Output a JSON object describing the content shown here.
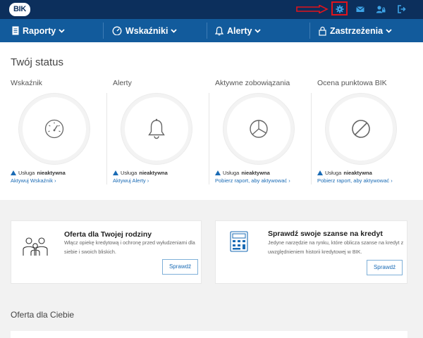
{
  "header": {
    "logo_text": "BIK",
    "icons": [
      "settings-icon",
      "mail-icon",
      "user-lock-icon",
      "logout-icon"
    ],
    "highlight_color": "#e0141c"
  },
  "nav": {
    "items": [
      {
        "label": "Raporty",
        "icon": "document-icon"
      },
      {
        "label": "Wskaźniki",
        "icon": "gauge-icon"
      },
      {
        "label": "Alerty",
        "icon": "bell-icon"
      },
      {
        "label": "Zastrzeżenia",
        "icon": "lock-icon"
      }
    ]
  },
  "status": {
    "title": "Twój status",
    "columns": [
      {
        "label": "Wskaźnik",
        "icon": "gauge-icon",
        "warn_prefix": "Usługa",
        "warn_state": "nieaktywna",
        "link": "Aktywuj Wskaźnik ›"
      },
      {
        "label": "Alerty",
        "icon": "bell-icon",
        "warn_prefix": "Usługa",
        "warn_state": "nieaktywna",
        "link": "Aktywuj Alerty ›"
      },
      {
        "label": "Aktywne zobowiązania",
        "icon": "pie-chart-icon",
        "warn_prefix": "Usługa",
        "warn_state": "nieaktywna",
        "link": "Pobierz raport, aby aktywować ›"
      },
      {
        "label": "Ocena punktowa BIK",
        "icon": "prohibited-icon",
        "warn_prefix": "Usługa",
        "warn_state": "nieaktywna",
        "link": "Pobierz raport, aby aktywować ›"
      }
    ]
  },
  "cards": [
    {
      "title": "Oferta dla Twojej rodziny",
      "description": "Włącz opiekę kredytową i ochronę przed wyłudzeniami dla siebie i swoich bliskich.",
      "button": "Sprawdź",
      "icon": "family-icon"
    },
    {
      "title": "Sprawdź swoje szanse na kredyt",
      "description": "Jedyne narzędzie na rynku, które oblicza szanse na kredyt z uwzględnieniem historii kredytowej w BIK.",
      "button": "Sprawdź",
      "icon": "calculator-icon"
    }
  ],
  "offer_section": {
    "title": "Oferta dla Ciebie"
  },
  "colors": {
    "topbar": "#0c2f5c",
    "navbar": "#125b9c",
    "link": "#1a6bb5",
    "warning": "#1a6bb5"
  }
}
